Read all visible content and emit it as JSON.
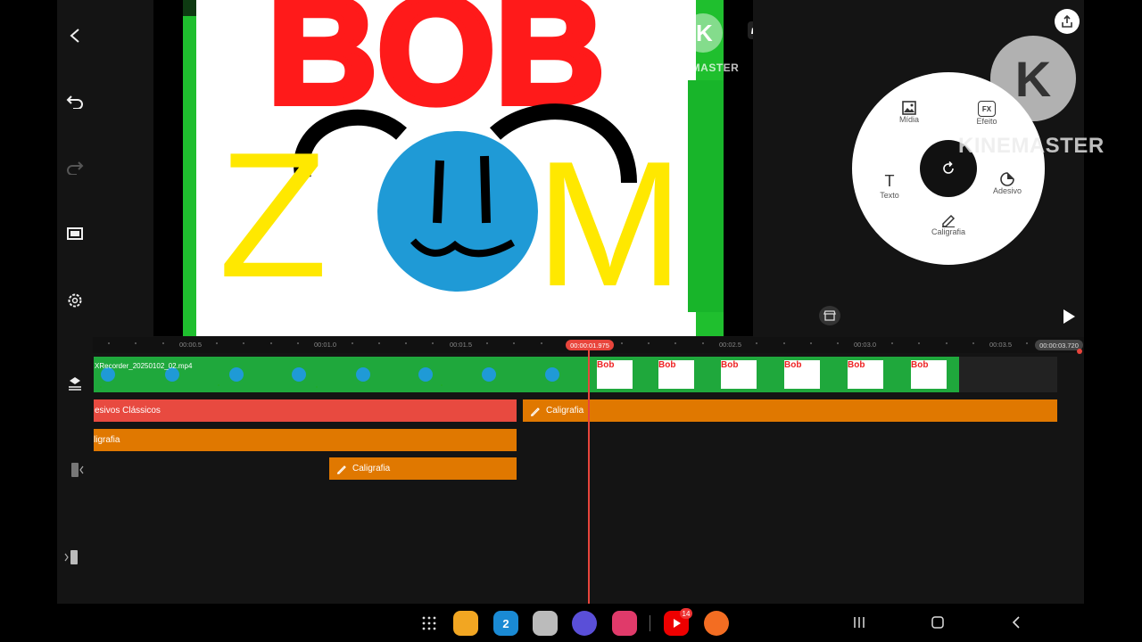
{
  "preview": {
    "watermark_small": "KINEMASTER",
    "watermark_small_letter": "K",
    "art_title_word1": "BOB",
    "art_title_word2_left": "Z",
    "art_title_word2_right": "M"
  },
  "watermark_large": {
    "letter": "K",
    "text": "KINEMASTER"
  },
  "wheel_menu": {
    "media": "Mídia",
    "effect": "Efeito",
    "text": "Texto",
    "sticker": "Adesivo",
    "handwriting": "Caligrafia",
    "effect_badge": "FX",
    "text_glyph": "T"
  },
  "timeline": {
    "ticks": [
      "00:00.5",
      "00:01.0",
      "00:01.5",
      "00:02.5",
      "00:03.0",
      "00:03.5"
    ],
    "current_time": "00:00:01.975",
    "end_time": "00:00:03.720",
    "clip_name": "XRecorder_20250102_02.mp4",
    "thumb_caption": "Bob",
    "layers": {
      "sticker_classic": "esivos Clássicos",
      "handwriting_1": "Caligrafia",
      "handwriting_2": "ligrafia",
      "handwriting_3": "Caligrafia"
    }
  },
  "colors": {
    "accent": "#e8453c",
    "layer_orange": "#e07800",
    "layer_red": "#e84a40",
    "clip_green": "#1fa83c"
  },
  "icons": {
    "back": "chevron-left-icon",
    "undo": "undo-icon",
    "redo": "redo-icon",
    "capture": "capture-icon",
    "settings": "gear-icon",
    "export": "share-icon",
    "play": "play-icon",
    "store": "store-icon",
    "rotate": "rotate-icon"
  },
  "dock": {
    "calendar_day": "2",
    "youtube_badge": "14"
  }
}
